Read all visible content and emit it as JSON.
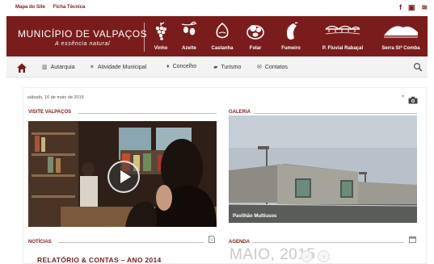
{
  "topbar": {
    "links": [
      "Mapa do Site",
      "Ficha Técnica"
    ],
    "social": [
      {
        "icon": "facebook-icon",
        "glyph": "f"
      },
      {
        "icon": "youtube-icon",
        "glyph": "▣"
      },
      {
        "icon": "rss-icon",
        "glyph": "≋"
      }
    ]
  },
  "header": {
    "title": "MUNICÍPIO DE VALPAÇOS",
    "tagline": "A essência natural",
    "products": [
      "Vinho",
      "Azeite",
      "Castanha",
      "Folar",
      "Fumeiro",
      "P. Fluvial Rabaçal",
      "Serra Stª Comba"
    ]
  },
  "nav": {
    "items": [
      {
        "label": "Autarquia",
        "glyph": "▥"
      },
      {
        "label": "Atividade Municipal",
        "glyph": "✶"
      },
      {
        "label": "Concelho",
        "glyph": "♦"
      },
      {
        "label": "Turismo",
        "glyph": "▰"
      },
      {
        "label": "Contatos",
        "glyph": "✉"
      }
    ]
  },
  "content": {
    "date": "sábado, 16 de maio de 2015",
    "visite_title": "VISITE VALPAÇOS",
    "galeria_title": "GALERIA",
    "gallery_caption": "Pavilhão Multiusos",
    "noticias_title": "NOTÍCIAS",
    "agenda_title": "AGENDA",
    "news_headline": "RELATÓRIO & CONTAS – ANO 2014",
    "agenda_month": "MAIO, 2015",
    "prev_glyph": "‹",
    "next_glyph": "›"
  },
  "colors": {
    "brand": "#7b1c1c",
    "nav_bg": "#f3f3f3"
  }
}
